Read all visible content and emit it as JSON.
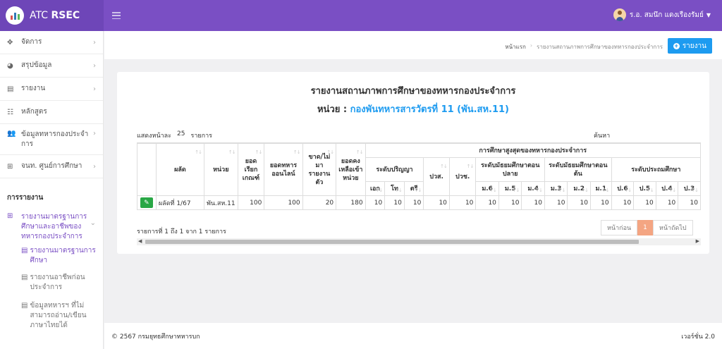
{
  "app": {
    "name_prefix": "ATC",
    "name_bold": "RSEC"
  },
  "user": {
    "name": "ร.อ. สมนึก แดงเรืองรัมย์"
  },
  "sidebar": {
    "items": [
      {
        "icon": "✥",
        "label": "จัดการ"
      },
      {
        "icon": "◕",
        "label": "สรุปข้อมูล"
      },
      {
        "icon": "▤",
        "label": "รายงาน"
      },
      {
        "icon": "☷",
        "label": "หลักสูตร"
      },
      {
        "icon": "👥",
        "label": "ข้อมูลทหารกองประจำการ"
      },
      {
        "icon": "⊞",
        "label": "จนท. ศูนย์การศึกษา"
      }
    ],
    "section_title": "การรายงาน",
    "open_item": {
      "icon": "⊞",
      "label": "รายงานมาตรฐานการศึกษาและอาชีพของทหารกองประจำการ"
    },
    "children": [
      {
        "label": "รายงานมาตรฐานการศึกษา"
      },
      {
        "label": "รายงานอาชีพก่อนประจำการ"
      },
      {
        "label": "ข้อมูลทหารฯ ที่ไม่สามารถอ่าน/เขียนภาษาไทยได้"
      }
    ]
  },
  "breadcrumb": {
    "home": "หน้าแรก",
    "current": "รายงานสถานภาพการศึกษาของทหารกองประจำการ"
  },
  "report_button": "รายงาน",
  "report": {
    "title": "รายงานสถานภาพการศึกษาของทหารกองประจำการ",
    "unit_label": "หน่วย :",
    "unit_name": "กองพันทหารสารวัตรที่ 11 (พัน.สห.11)"
  },
  "table_controls": {
    "show_label": "แสดงหน้าละ",
    "page_size": "25",
    "items_label": "รายการ",
    "search_label": "ค้นหา"
  },
  "table": {
    "headers": {
      "result": "ผลัด",
      "unit": "หน่วย",
      "called": "ยอดเรียกเกณฑ์",
      "online": "ยอดทหารออนไลน์",
      "absent": "ขาด/ไม่มารายงานตัว",
      "remain": "ยอดคงเหลือเข้าหน่วย",
      "top": "การศึกษาสูงสุดของทหารกองประจำการ",
      "degree": "ระดับปริญญา",
      "pwc": "ปวส.",
      "pwch": "ปวช.",
      "upper": "ระดับมัธยมศึกษาตอนปลาย",
      "lower": "ระดับมัธยมศึกษาตอนต้น",
      "primary": "ระดับประถมศึกษา",
      "phd": "เอก",
      "master": "โท",
      "bachelor": "ตรี",
      "m6": "ม.6",
      "m5": "ม.5",
      "m4": "ม.4",
      "m3": "ม.3",
      "m2": "ม.2",
      "m1": "ม.1",
      "p6": "ป.6",
      "p5": "ป.5",
      "p4": "ป.4",
      "p3": "ป.3"
    },
    "rows": [
      {
        "result": "ผลัดที่ 1/67",
        "unit": "พัน.สห.11",
        "called": "100",
        "online": "100",
        "absent": "20",
        "remain": "180",
        "phd": "10",
        "master": "10",
        "bachelor": "10",
        "pwc": "10",
        "pwch": "10",
        "m6": "10",
        "m5": "10",
        "m4": "10",
        "m3": "10",
        "m2": "10",
        "m1": "10",
        "p6": "10",
        "p5": "10",
        "p4": "10",
        "p3": "10"
      }
    ]
  },
  "pagination": {
    "info": "รายการที่ 1 ถึง 1 จาก 1 รายการ",
    "prev": "หน้าก่อน",
    "current": "1",
    "next": "หน้าถัดไป"
  },
  "footer": {
    "copyright": "© 2567 กรมยุทธศึกษาทหารบก",
    "version": "เวอร์ชั่น 2.0"
  }
}
